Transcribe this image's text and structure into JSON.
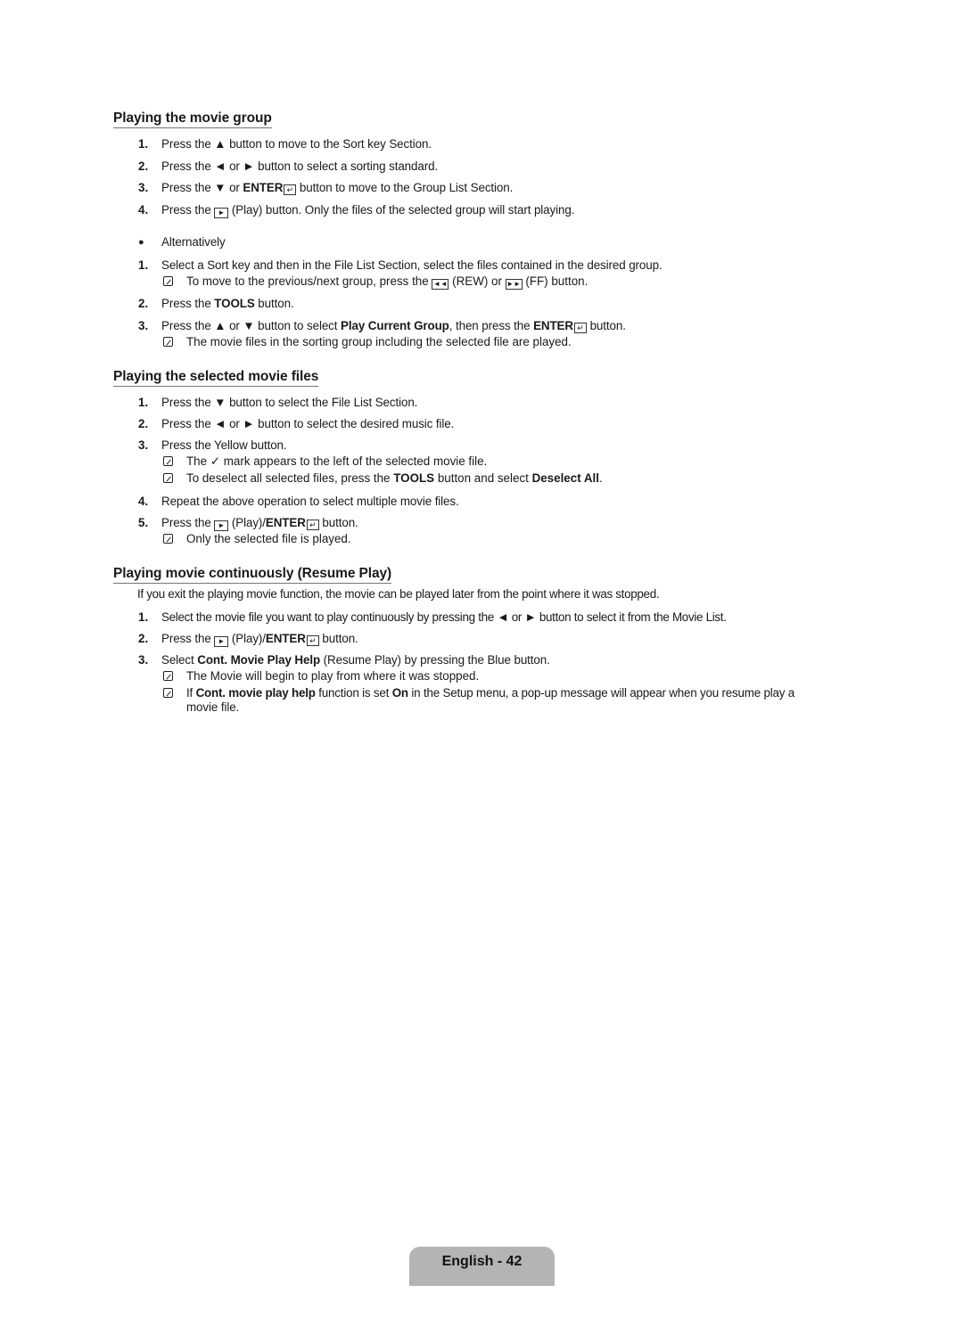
{
  "sections": [
    {
      "title": "Playing the movie group",
      "steps": [
        {
          "n": "1.",
          "pre": "Press the ",
          "icon": "▲",
          "post": " button to move to the Sort key Section."
        },
        {
          "n": "2.",
          "pre": "Press the ",
          "icon": "◄",
          "mid": " or ",
          "icon2": "►",
          "post": " button to select a sorting standard."
        },
        {
          "n": "3.",
          "pre": "Press the ",
          "icon": "▼",
          "mid": " or ",
          "bold": "ENTER",
          "post": " button to move to the Group List Section."
        },
        {
          "n": "4.",
          "pre": "Press the ",
          "post": " (Play) button. Only the files of the selected group will start playing."
        }
      ],
      "alt_label": "Alternatively",
      "alt_steps": [
        {
          "n": "1.",
          "text": "Select a Sort key and then in the File List Section, select the files contained in the desired group.",
          "note": {
            "pre": "To move to the previous/next group, press the ",
            "mid": " (REW) or ",
            "post": " (FF) button."
          }
        },
        {
          "n": "2.",
          "pre": "Press the ",
          "bold": "TOOLS",
          "post": " button."
        },
        {
          "n": "3.",
          "pre": "Press the ",
          "icon": "▲",
          "mid": " or ",
          "icon2": "▼",
          "mid2": " button to select ",
          "bold": "Play Current Group",
          "mid3": ", then press the ",
          "bold2": "ENTER",
          "post": " button.",
          "note": "The movie files in the sorting group including the selected file are played."
        }
      ]
    },
    {
      "title": "Playing the selected movie files",
      "steps": [
        {
          "n": "1.",
          "pre": "Press the ",
          "icon": "▼",
          "post": " button to select the File List Section."
        },
        {
          "n": "2.",
          "pre": "Press the ",
          "icon": "◄",
          "mid": " or ",
          "icon2": "►",
          "post": " button to select the desired music file."
        },
        {
          "n": "3.",
          "text": "Press the Yellow button.",
          "note1": {
            "pre": "The ",
            "icon": "✓",
            "post": " mark appears to the left of the selected movie file."
          },
          "note2": {
            "pre": "To deselect all selected files, press the ",
            "bold": "TOOLS",
            "mid": " button and select ",
            "bold2": "Deselect All",
            "post": "."
          }
        },
        {
          "n": "4.",
          "text": "Repeat the above operation to select multiple movie files."
        },
        {
          "n": "5.",
          "pre": "Press the ",
          "mid": " (Play)/",
          "bold": "ENTER",
          "post": " button.",
          "note": "Only the selected file is played."
        }
      ]
    },
    {
      "title": "Playing movie continuously (Resume Play)",
      "intro": "If you exit the playing movie function, the movie can be played later from the point where it was stopped.",
      "steps": [
        {
          "n": "1.",
          "pre": "Select the movie file you want to play continuously by pressing the ",
          "icon": "◄",
          "mid": " or ",
          "icon2": "►",
          "post": " button to select it from the Movie List."
        },
        {
          "n": "2.",
          "pre": "Press the ",
          "mid": " (Play)/",
          "bold": "ENTER",
          "post": " button."
        },
        {
          "n": "3.",
          "pre": "Select ",
          "bold": "Cont. Movie Play Help",
          "post": " (Resume Play) by pressing the Blue button.",
          "note1": "The Movie will begin to play from where it was stopped.",
          "note2": {
            "pre": "If ",
            "bold": "Cont. movie play help",
            "mid": " function is set ",
            "bold2": "On",
            "post": " in the Setup menu, a pop-up message will appear when you resume play a",
            "cont": "movie file."
          }
        }
      ]
    }
  ],
  "icons": {
    "play": "►",
    "rew": "◄◄",
    "ff": "►►",
    "enter": "↵",
    "bullet": "●"
  },
  "footer": {
    "label": "English - 42"
  }
}
